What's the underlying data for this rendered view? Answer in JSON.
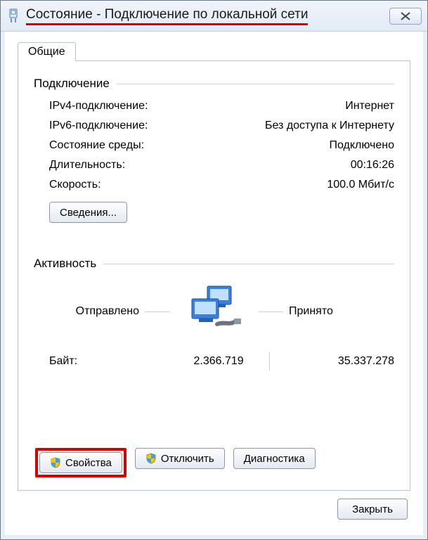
{
  "window": {
    "title": "Состояние - Подключение по локальной сети"
  },
  "tabs": {
    "general": "Общие"
  },
  "connection": {
    "heading": "Подключение",
    "ipv4_label": "IPv4-подключение:",
    "ipv4_value": "Интернет",
    "ipv6_label": "IPv6-подключение:",
    "ipv6_value": "Без доступа к Интернету",
    "media_label": "Состояние среды:",
    "media_value": "Подключено",
    "duration_label": "Длительность:",
    "duration_value": "00:16:26",
    "speed_label": "Скорость:",
    "speed_value": "100.0 Мбит/с",
    "details_button": "Сведения..."
  },
  "activity": {
    "heading": "Активность",
    "sent_label": "Отправлено",
    "recv_label": "Принято",
    "bytes_label": "Байт:",
    "bytes_sent": "2.366.719",
    "bytes_recv": "35.337.278"
  },
  "buttons": {
    "properties": "Свойства",
    "disable": "Отключить",
    "diagnose": "Диагностика",
    "close": "Закрыть"
  }
}
